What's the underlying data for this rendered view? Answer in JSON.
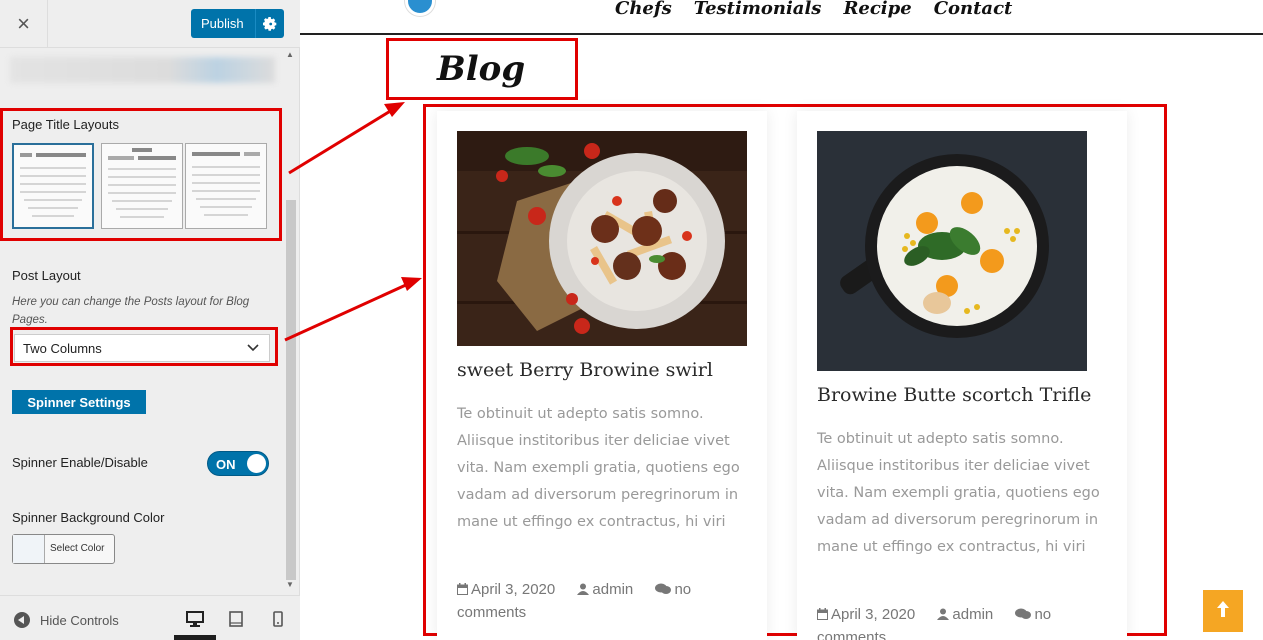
{
  "customizer": {
    "close_icon": "×",
    "publish_label": "Publish",
    "page_title_layouts": {
      "label": "Page Title Layouts"
    },
    "post_layout": {
      "label": "Post Layout",
      "description": "Here you can change the Posts layout for Blog Pages.",
      "selected": "Two Columns"
    },
    "spinner_settings_label": "Spinner Settings",
    "spinner_toggle": {
      "label": "Spinner Enable/Disable",
      "state": "ON"
    },
    "spinner_bg": {
      "label": "Spinner Background Color",
      "button": "Select Color"
    },
    "footer": {
      "hide_controls": "Hide Controls"
    }
  },
  "site": {
    "nav": [
      "Chefs",
      "Testimonials",
      "Recipe",
      "Contact"
    ],
    "page_title": "Blog",
    "posts": [
      {
        "title": "sweet Berry Browine swirl",
        "excerpt": "Te obtinuit ut adepto satis somno. Aliisque institoribus iter deliciae vivet vita. Nam exempli gratia, quotiens ego vadam ad diversorum peregrinorum in mane ut effingo ex contractus, hi viri",
        "date": "April 3, 2020",
        "author": "admin",
        "comments": "no comments"
      },
      {
        "title": "Browine Butte scortch Trifle",
        "excerpt": "Te obtinuit ut adepto satis somno. Aliisque institoribus iter deliciae vivet vita. Nam exempli gratia, quotiens ego vadam ad diversorum peregrinorum in mane ut effingo ex contractus, hi viri",
        "date": "April 3, 2020",
        "author": "admin",
        "comments": "no comments"
      }
    ]
  },
  "colors": {
    "accent": "#0073aa",
    "highlight": "#e00000",
    "back_to_top": "#f5a623"
  },
  "icons": [
    "close-icon",
    "gear-icon",
    "chevron-down-icon",
    "calendar-icon",
    "user-icon",
    "comments-icon",
    "desktop-icon",
    "tablet-icon",
    "mobile-icon",
    "arrow-up-icon"
  ]
}
